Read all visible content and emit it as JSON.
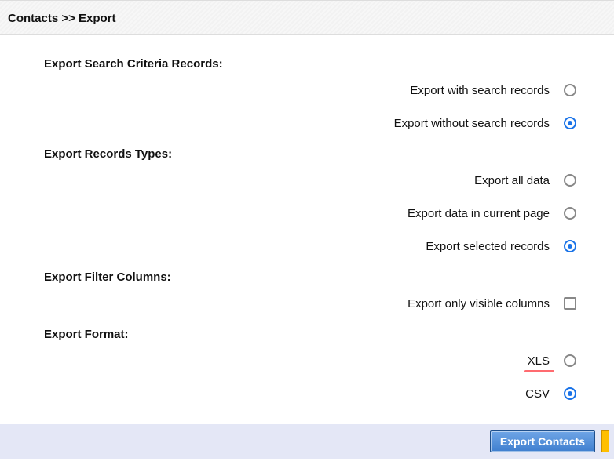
{
  "breadcrumb": "Contacts >> Export",
  "sections": {
    "criteria": {
      "label": "Export Search Criteria Records:",
      "opt_with": "Export with search records",
      "opt_without": "Export without search records"
    },
    "types": {
      "label": "Export Records Types:",
      "opt_all": "Export all data",
      "opt_page": "Export data in current page",
      "opt_selected": "Export selected records"
    },
    "filter": {
      "label": "Export Filter Columns:",
      "opt_visible": "Export only visible columns"
    },
    "format": {
      "label": "Export Format:",
      "opt_xls": "XLS",
      "opt_csv": "CSV"
    }
  },
  "footer": {
    "export_btn": "Export Contacts"
  },
  "state": {
    "criteria": "without",
    "types": "selected",
    "filter_visible": false,
    "format": "csv"
  }
}
